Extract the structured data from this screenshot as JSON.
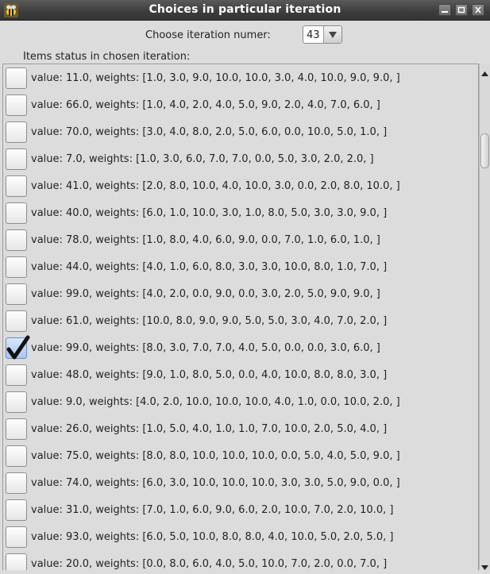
{
  "window": {
    "title": "Choices in particular iteration"
  },
  "iteration": {
    "label": "Choose iteration numer:",
    "selected": "43"
  },
  "list": {
    "label": "Items status in chosen iteration:",
    "items": [
      {
        "text": "value: 11.0, weights: [1.0, 3.0, 9.0, 10.0, 10.0, 3.0, 4.0, 10.0, 9.0, 9.0, ]",
        "checked": false
      },
      {
        "text": "value: 66.0, weights: [1.0, 4.0, 2.0, 4.0, 5.0, 9.0, 2.0, 4.0, 7.0, 6.0, ]",
        "checked": false
      },
      {
        "text": "value: 70.0, weights: [3.0, 4.0, 8.0, 2.0, 5.0, 6.0, 0.0, 10.0, 5.0, 1.0, ]",
        "checked": false
      },
      {
        "text": "value: 7.0, weights: [1.0, 3.0, 6.0, 7.0, 7.0, 0.0, 5.0, 3.0, 2.0, 2.0, ]",
        "checked": false
      },
      {
        "text": "value: 41.0, weights: [2.0, 8.0, 10.0, 4.0, 10.0, 3.0, 0.0, 2.0, 8.0, 10.0, ]",
        "checked": false
      },
      {
        "text": "value: 40.0, weights: [6.0, 1.0, 10.0, 3.0, 1.0, 8.0, 5.0, 3.0, 3.0, 9.0, ]",
        "checked": false
      },
      {
        "text": "value: 78.0, weights: [1.0, 8.0, 4.0, 6.0, 9.0, 0.0, 7.0, 1.0, 6.0, 1.0, ]",
        "checked": false
      },
      {
        "text": "value: 44.0, weights: [4.0, 1.0, 6.0, 8.0, 3.0, 3.0, 10.0, 8.0, 1.0, 7.0, ]",
        "checked": false
      },
      {
        "text": "value: 99.0, weights: [4.0, 2.0, 0.0, 9.0, 0.0, 3.0, 2.0, 5.0, 9.0, 9.0, ]",
        "checked": false
      },
      {
        "text": "value: 61.0, weights: [10.0, 8.0, 9.0, 9.0, 5.0, 5.0, 3.0, 4.0, 7.0, 2.0, ]",
        "checked": false
      },
      {
        "text": "value: 99.0, weights: [8.0, 3.0, 7.0, 7.0, 4.0, 5.0, 0.0, 0.0, 3.0, 6.0, ]",
        "checked": true
      },
      {
        "text": "value: 48.0, weights: [9.0, 1.0, 8.0, 5.0, 0.0, 4.0, 10.0, 8.0, 8.0, 3.0, ]",
        "checked": false
      },
      {
        "text": "value: 9.0, weights: [4.0, 2.0, 10.0, 10.0, 10.0, 4.0, 1.0, 0.0, 10.0, 2.0, ]",
        "checked": false
      },
      {
        "text": "value: 26.0, weights: [1.0, 5.0, 4.0, 1.0, 1.0, 7.0, 10.0, 2.0, 5.0, 4.0, ]",
        "checked": false
      },
      {
        "text": "value: 75.0, weights: [8.0, 8.0, 10.0, 10.0, 10.0, 0.0, 5.0, 4.0, 5.0, 9.0, ]",
        "checked": false
      },
      {
        "text": "value: 74.0, weights: [6.0, 3.0, 10.0, 10.0, 10.0, 3.0, 3.0, 5.0, 9.0, 0.0, ]",
        "checked": false
      },
      {
        "text": "value: 31.0, weights: [7.0, 1.0, 6.0, 9.0, 6.0, 2.0, 10.0, 7.0, 2.0, 10.0, ]",
        "checked": false
      },
      {
        "text": "value: 93.0, weights: [6.0, 5.0, 10.0, 8.0, 8.0, 4.0, 10.0, 5.0, 2.0, 5.0, ]",
        "checked": false
      },
      {
        "text": "value: 20.0, weights: [0.0, 8.0, 6.0, 4.0, 5.0, 10.0, 7.0, 2.0, 0.0, 7.0, ]",
        "checked": false
      }
    ]
  },
  "icons": {
    "app": "bee-app-icon",
    "minimize": "minimize-icon",
    "maximize": "maximize-icon",
    "close": "close-icon",
    "dropdown": "chevron-down-icon",
    "check": "checkmark-icon"
  }
}
